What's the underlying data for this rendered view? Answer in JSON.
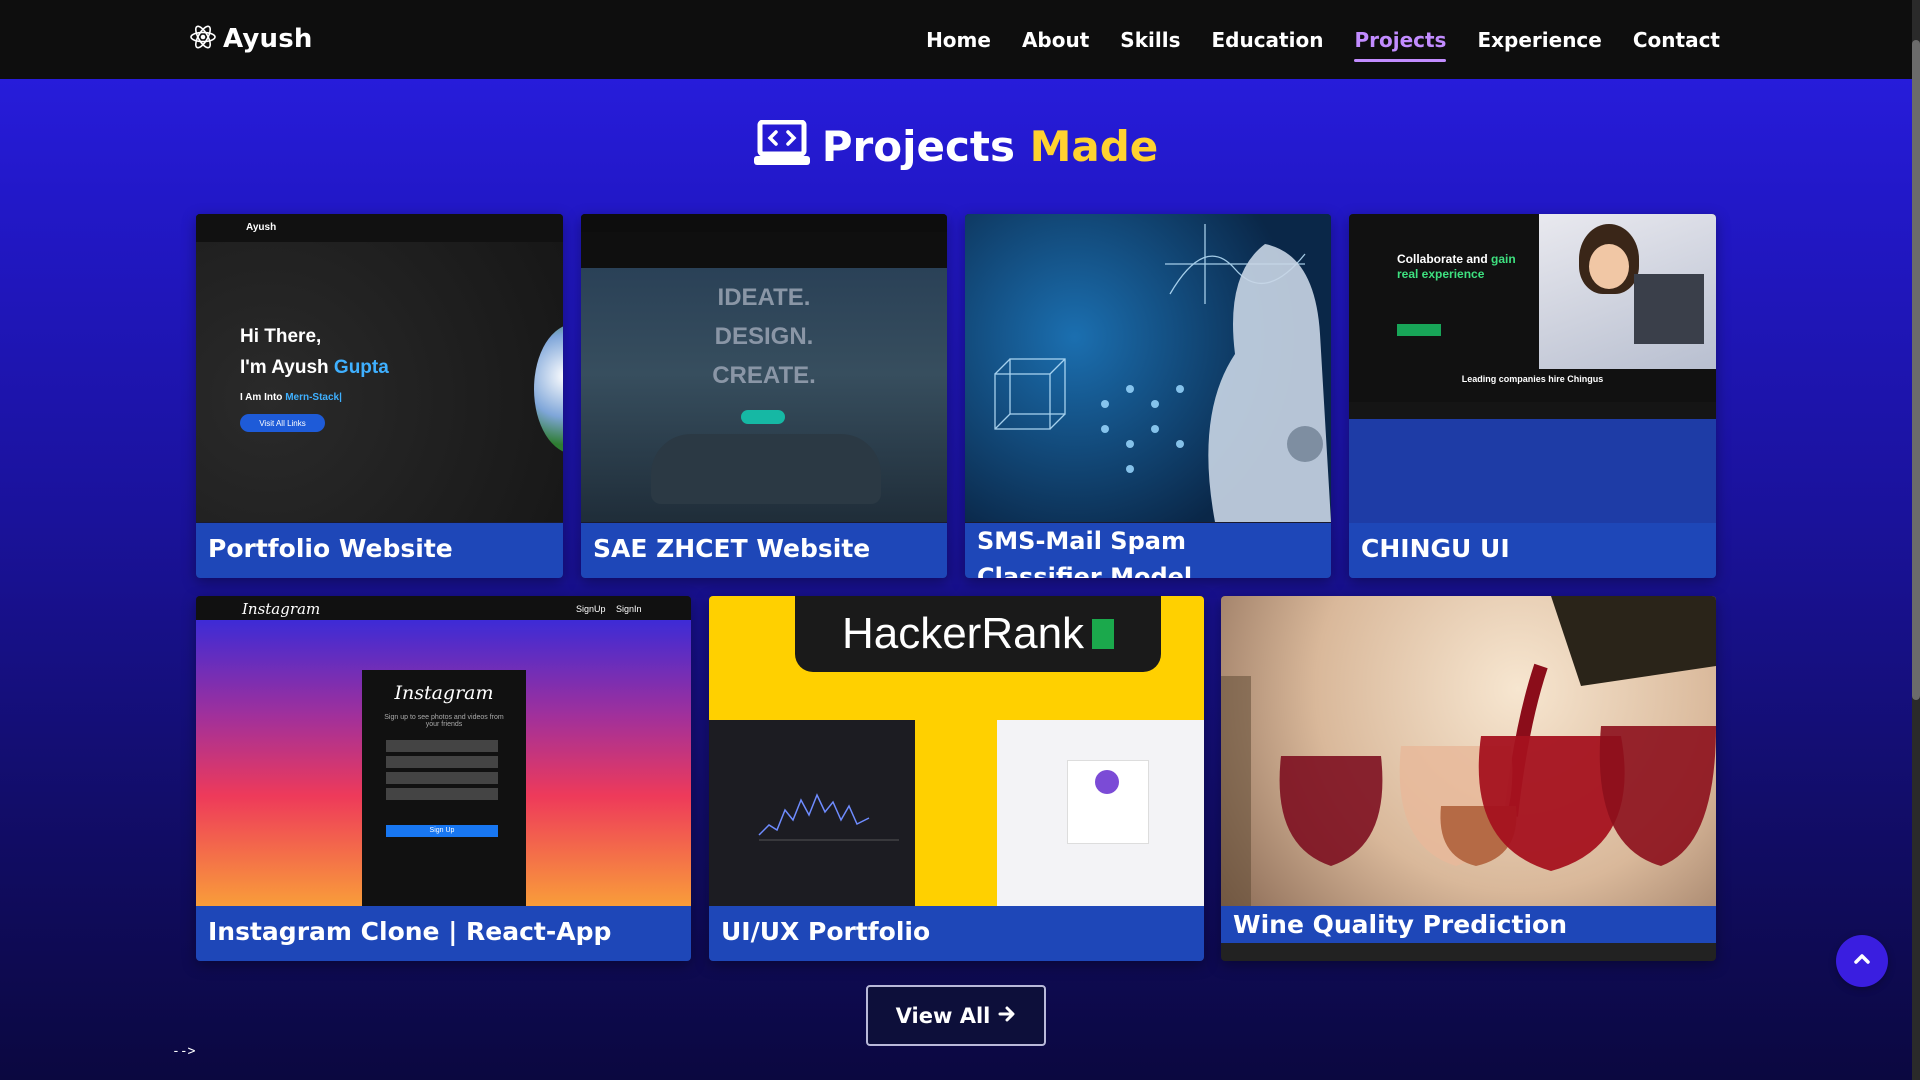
{
  "brand": {
    "name": "Ayush"
  },
  "nav": {
    "links": [
      {
        "label": "Home",
        "active": false
      },
      {
        "label": "About",
        "active": false
      },
      {
        "label": "Skills",
        "active": false
      },
      {
        "label": "Education",
        "active": false
      },
      {
        "label": "Projects",
        "active": true
      },
      {
        "label": "Experience",
        "active": false
      },
      {
        "label": "Contact",
        "active": false
      }
    ]
  },
  "section": {
    "title_main": "Projects",
    "title_accent": "Made"
  },
  "projects": [
    {
      "title": "Portfolio Website"
    },
    {
      "title": "SAE ZHCET Website"
    },
    {
      "title": "SMS-Mail Spam Classifier Model"
    },
    {
      "title": "CHINGU UI"
    },
    {
      "title": "Instagram Clone | React-App"
    },
    {
      "title": "UI/UX Portfolio"
    },
    {
      "title": "Wine Quality Prediction"
    }
  ],
  "thumb_text": {
    "portfolio": {
      "greet": "Hi There,",
      "name_pre": "I'm Ayush",
      "name_accent": "Gupta",
      "role_pre": "I Am Into",
      "role": "Mern-Stack|",
      "btn": "Visit All Links"
    },
    "sae": {
      "l1": "IDEATE.",
      "l2": "DESIGN.",
      "l3": "CREATE."
    },
    "chingu": {
      "h1": "Collaborate and",
      "h1_accent": "gain",
      "h2": "real experience",
      "companies": "Leading companies hire Chingus"
    },
    "insta": {
      "logo": "Instagram",
      "signup": "SignUp",
      "signin": "SignIn",
      "tagline": "Sign up to see photos and videos from your friends",
      "btn": "Sign Up"
    },
    "hacker": {
      "logo": "HackerRank"
    }
  },
  "actions": {
    "view_all": "View All"
  },
  "stray_text": "-->",
  "colors": {
    "accent_yellow": "#ffd230",
    "nav_active": "#c28cff",
    "title_bar": "#1e47b8"
  }
}
